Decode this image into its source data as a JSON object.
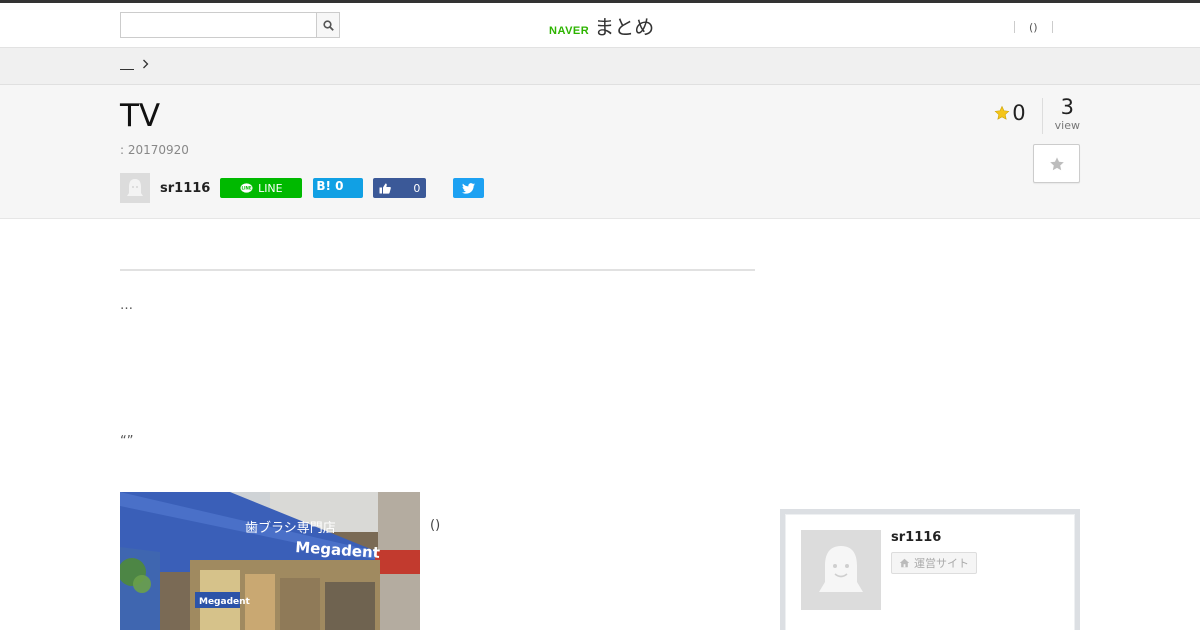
{
  "header": {
    "logo_naver": "NAVER",
    "logo_matome": "まとめ",
    "search": {
      "value": "",
      "placeholder": ""
    },
    "nav": {
      "item": "()"
    }
  },
  "breadcrumb": {
    "home": ""
  },
  "article": {
    "title": "TV",
    "date": ": 20170920",
    "author": "sr1116",
    "favorites": "0",
    "views": "3",
    "views_label": "view",
    "paragraph1": "…",
    "paragraph2": "“”",
    "photo_caption": "()",
    "photo_sign_jp": "歯ブラシ専門店",
    "photo_sign_brand": "Megadent",
    "photo_sign_brand2": "Megadent"
  },
  "share": {
    "line_label": "LINE",
    "hatena_label": "B! 0",
    "like_count": "0"
  },
  "sidebar": {
    "author_name": "sr1116",
    "site_button": "運営サイト"
  },
  "colors": {
    "naver_green": "#2db400",
    "line_green": "#00b900",
    "hatena_blue": "#11a0e4",
    "facebook_blue": "#3b5998",
    "twitter_blue": "#1da1f2",
    "star_yellow": "#f5c518"
  }
}
